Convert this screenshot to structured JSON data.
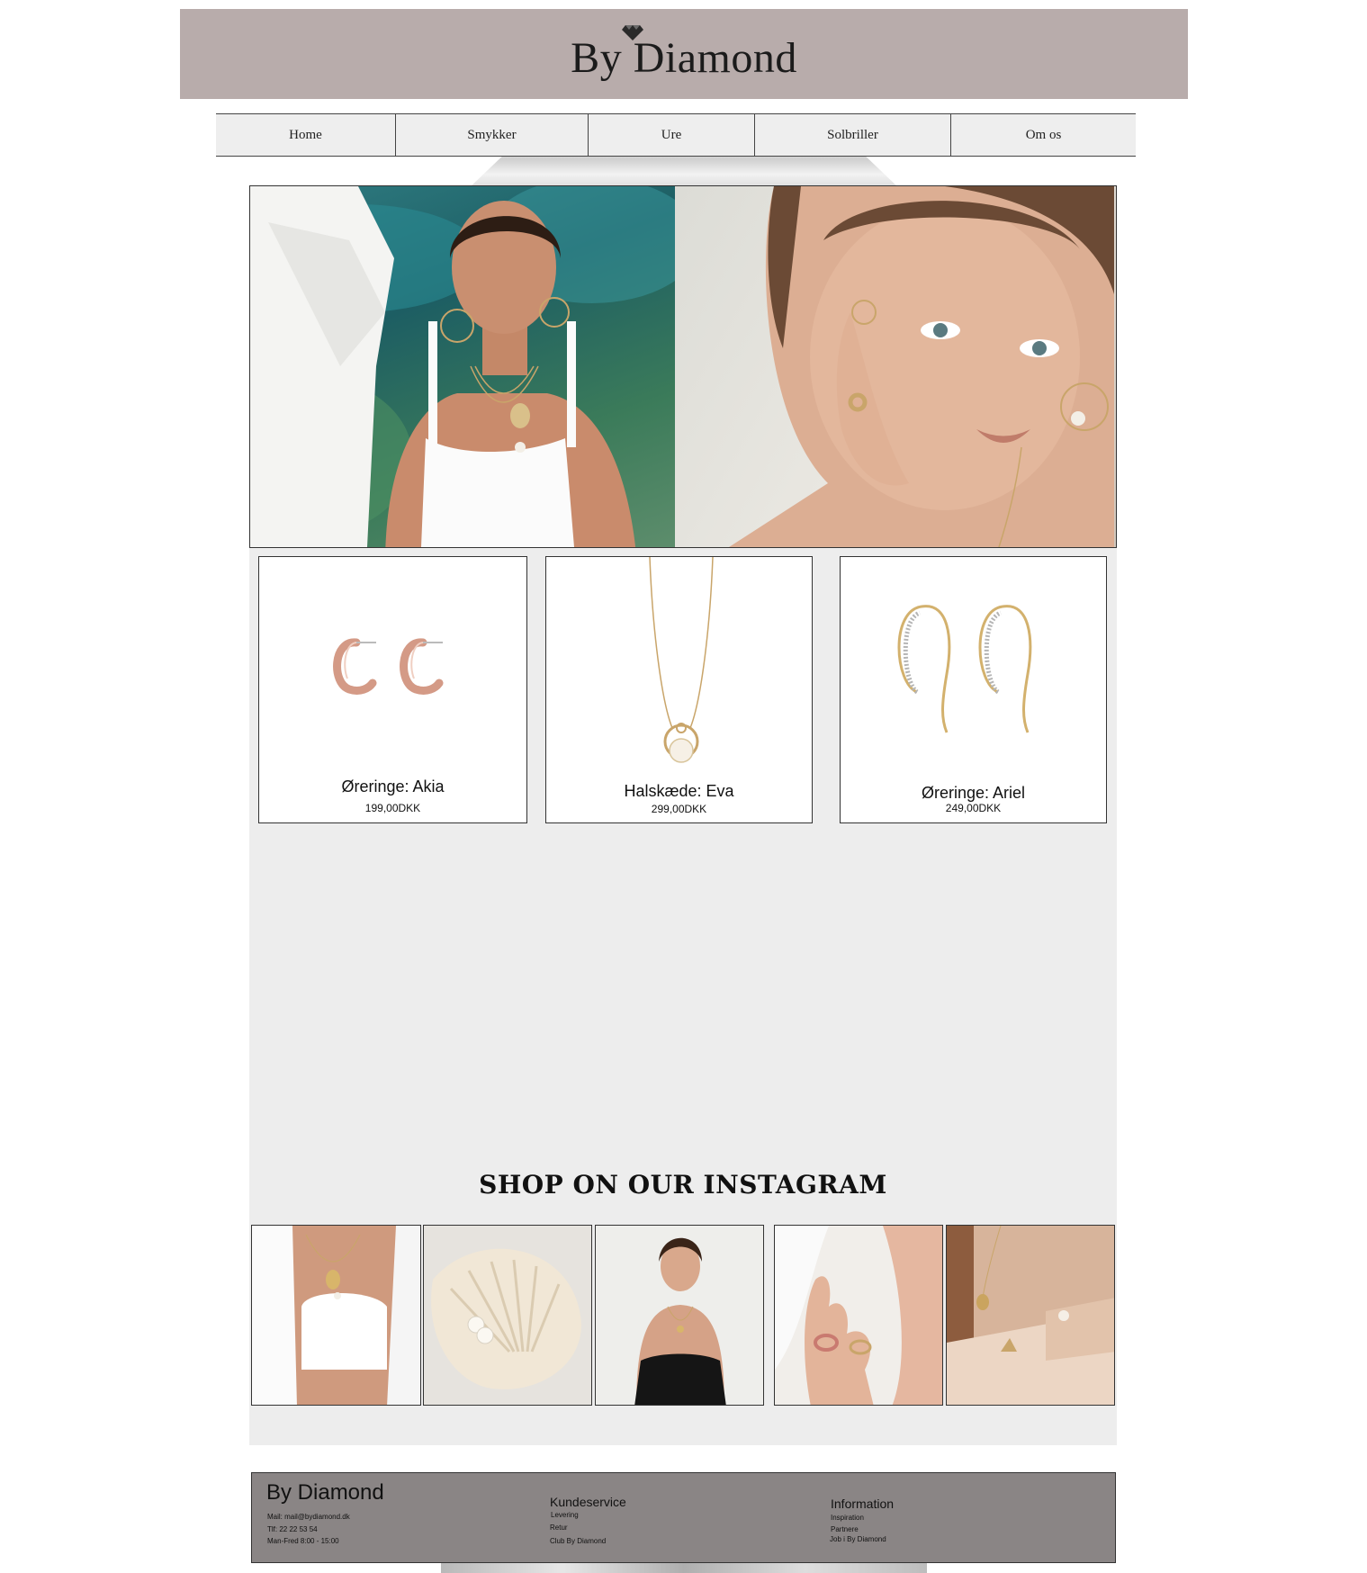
{
  "header": {
    "brand": "By Diamond"
  },
  "nav": {
    "items": [
      {
        "label": "Home"
      },
      {
        "label": "Smykker"
      },
      {
        "label": "Ure"
      },
      {
        "label": "Solbriller"
      },
      {
        "label": "Om os"
      }
    ]
  },
  "products": [
    {
      "name": "Øreringe: Akia",
      "price": "199,00DKK"
    },
    {
      "name": "Halskæde: Eva",
      "price": "299,00DKK"
    },
    {
      "name": "Øreringe: Ariel",
      "price": "249,00DKK"
    }
  ],
  "instagram": {
    "title": "SHOP ON OUR INSTAGRAM"
  },
  "footer": {
    "brand": "By Diamond",
    "contact": [
      "Mail: mail@bydiamond.dk",
      "Tlf: 22 22 53 54",
      "Man-Fred 8:00 - 15:00"
    ],
    "kundeservice": {
      "title": "Kundeservice",
      "links": [
        "Levering",
        "Retur",
        "Club By Diamond"
      ]
    },
    "information": {
      "title": "Information",
      "links": [
        "Inspiration",
        "Partnere",
        "Job i By Diamond"
      ]
    }
  },
  "colors": {
    "header_bg": "#b8acab",
    "content_bg": "#ededed",
    "footer_bg": "#8a8585",
    "gold": "#c9a56a",
    "rose_gold": "#d49a86"
  }
}
